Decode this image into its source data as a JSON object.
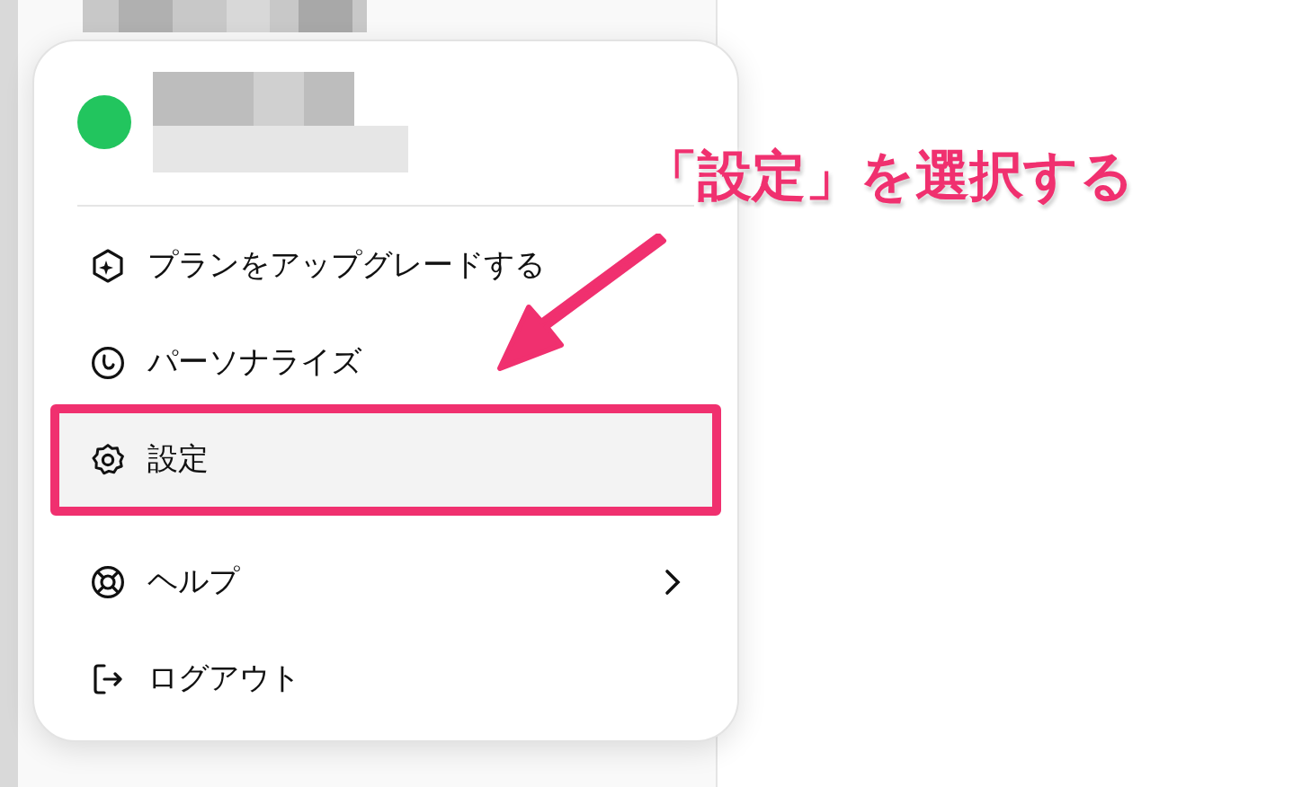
{
  "menu": {
    "items": [
      {
        "label": "プランをアップグレードする",
        "selected": false,
        "submenu": false
      },
      {
        "label": "パーソナライズ",
        "selected": false,
        "submenu": false
      },
      {
        "label": "設定",
        "selected": true,
        "submenu": false
      },
      {
        "label": "ヘルプ",
        "selected": false,
        "submenu": true
      },
      {
        "label": "ログアウト",
        "selected": false,
        "submenu": false
      }
    ]
  },
  "annotation": {
    "callout": "「設定」を選択する"
  }
}
